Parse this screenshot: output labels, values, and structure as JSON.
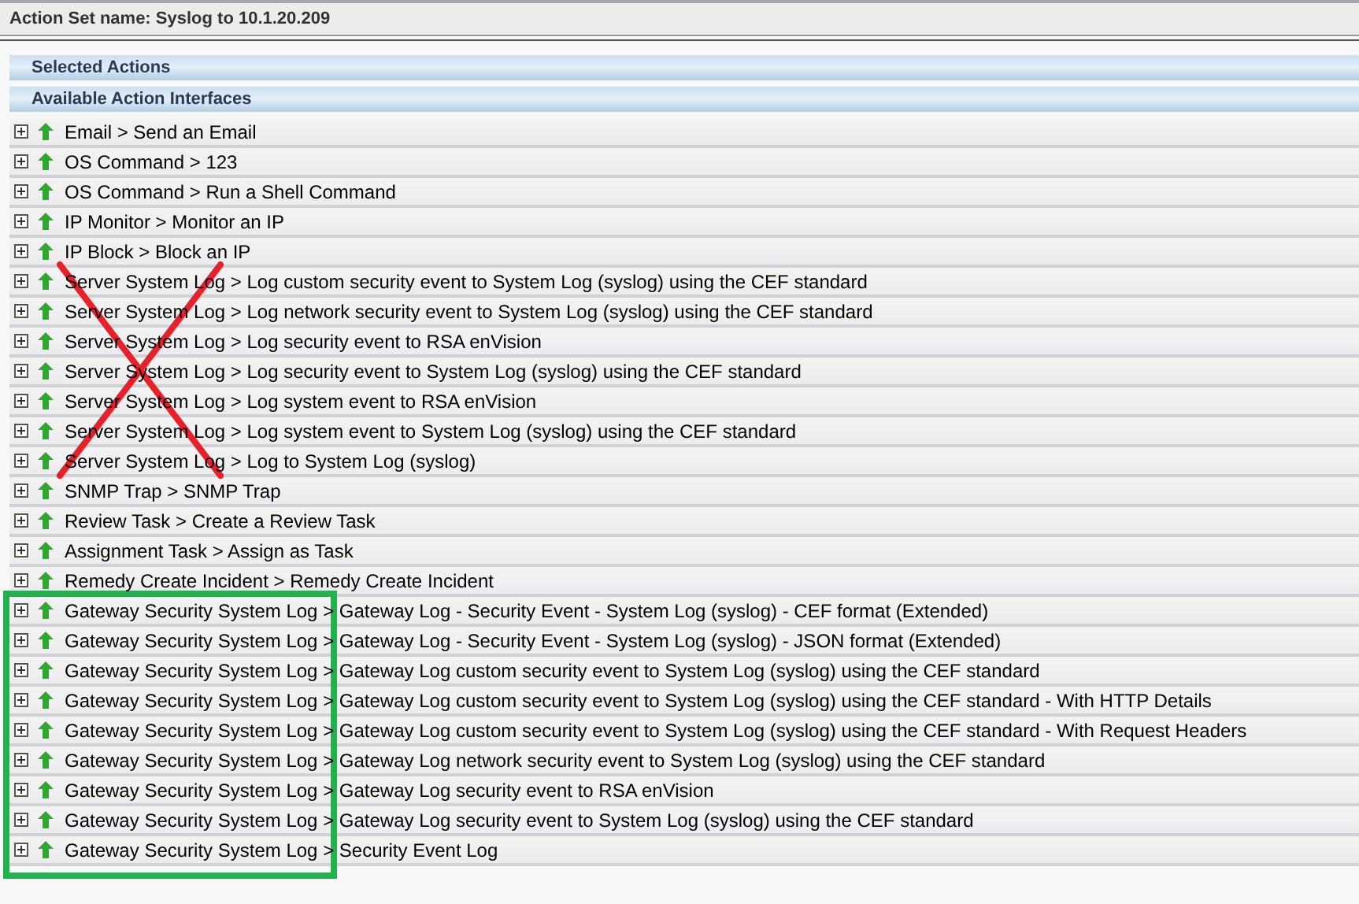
{
  "header": {
    "title": "Action Set name: Syslog to 10.1.20.209"
  },
  "sections": [
    {
      "title": "Selected Actions"
    },
    {
      "title": "Available Action Interfaces"
    }
  ],
  "actions": [
    {
      "label": "Email > Send an Email"
    },
    {
      "label": "OS Command > 123"
    },
    {
      "label": "OS Command > Run a Shell Command"
    },
    {
      "label": "IP Monitor > Monitor an IP"
    },
    {
      "label": "IP Block > Block an IP"
    },
    {
      "label": "Server System Log > Log custom security event to System Log (syslog) using the CEF standard"
    },
    {
      "label": "Server System Log > Log network security event to System Log (syslog) using the CEF standard"
    },
    {
      "label": "Server System Log > Log security event to RSA enVision"
    },
    {
      "label": "Server System Log > Log security event to System Log (syslog) using the CEF standard"
    },
    {
      "label": "Server System Log > Log system event to RSA enVision"
    },
    {
      "label": "Server System Log > Log system event to System Log (syslog) using the CEF standard"
    },
    {
      "label": "Server System Log > Log to System Log (syslog)"
    },
    {
      "label": "SNMP Trap > SNMP Trap"
    },
    {
      "label": "Review Task > Create a Review Task"
    },
    {
      "label": "Assignment Task > Assign as Task"
    },
    {
      "label": "Remedy Create Incident > Remedy Create Incident"
    },
    {
      "label": "Gateway Security System Log > Gateway Log - Security Event - System Log (syslog) - CEF format (Extended)"
    },
    {
      "label": "Gateway Security System Log > Gateway Log - Security Event - System Log (syslog) - JSON format (Extended)"
    },
    {
      "label": "Gateway Security System Log > Gateway Log custom security event to System Log (syslog) using the CEF standard"
    },
    {
      "label": "Gateway Security System Log > Gateway Log custom security event to System Log (syslog) using the CEF standard - With HTTP Details"
    },
    {
      "label": "Gateway Security System Log > Gateway Log custom security event to System Log (syslog) using the CEF standard - With Request Headers"
    },
    {
      "label": "Gateway Security System Log > Gateway Log network security event to System Log (syslog) using the CEF standard"
    },
    {
      "label": "Gateway Security System Log > Gateway Log security event to RSA enVision"
    },
    {
      "label": "Gateway Security System Log > Gateway Log security event to System Log (syslog) using the CEF standard"
    },
    {
      "label": "Gateway Security System Log > Security Event Log"
    }
  ],
  "annotations": [
    {
      "kind": "cross",
      "color": "#e8202a"
    },
    {
      "kind": "frame",
      "color": "#22b14c"
    }
  ]
}
